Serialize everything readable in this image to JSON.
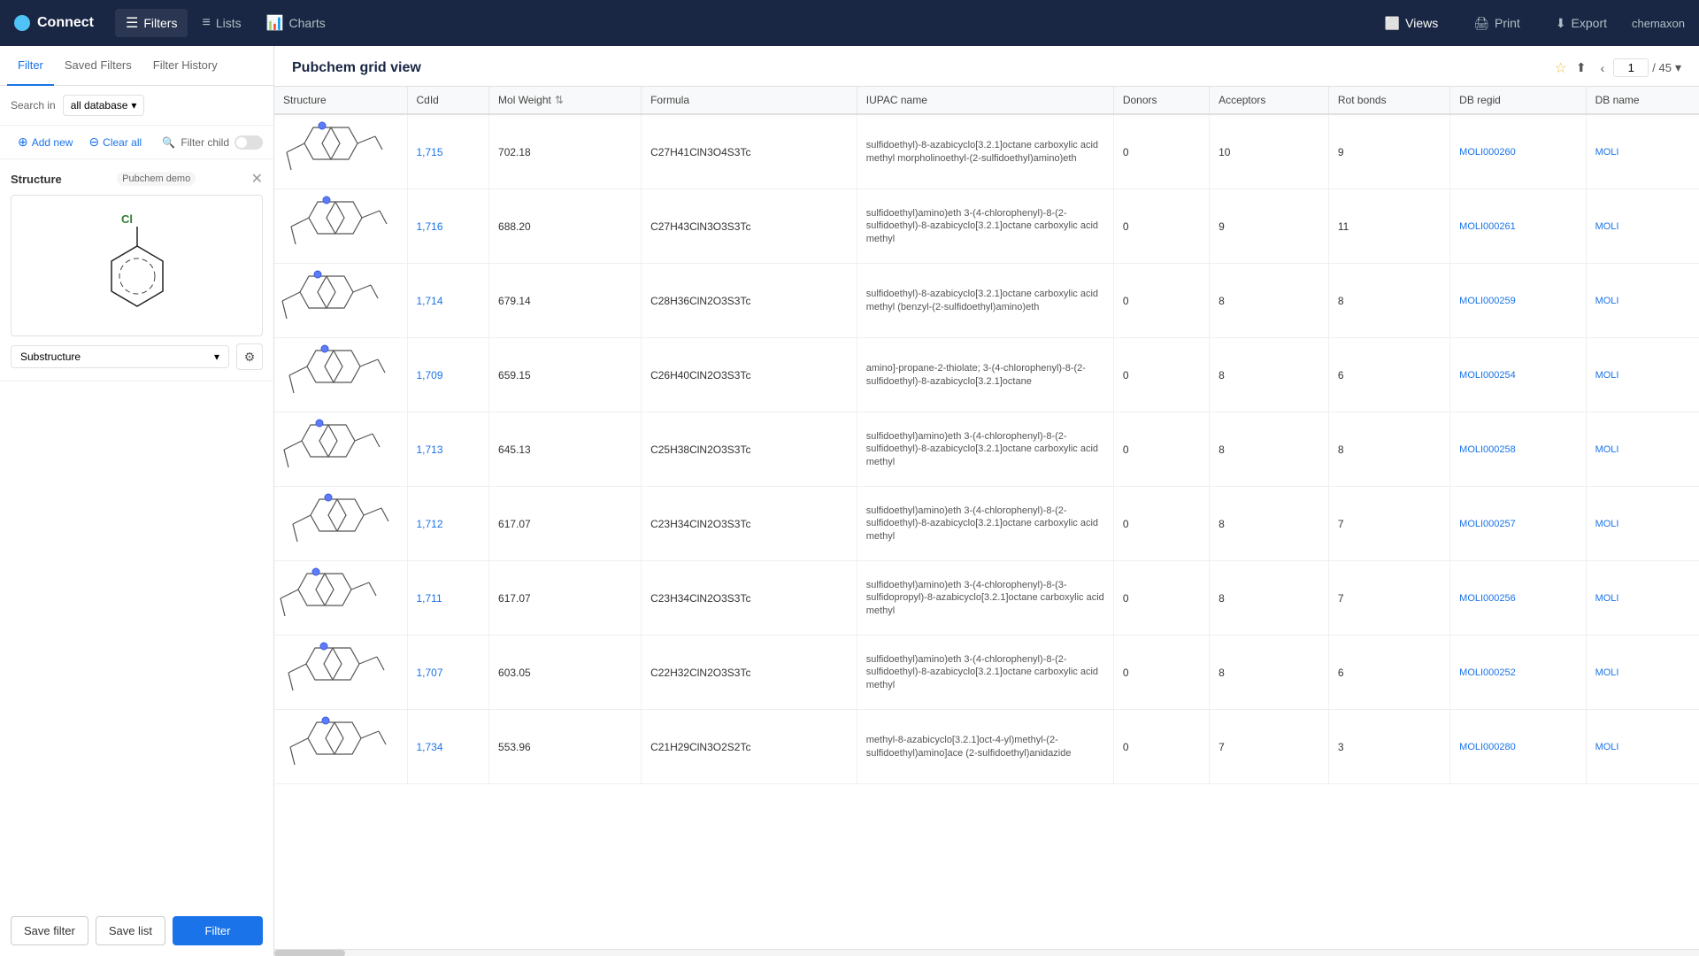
{
  "app": {
    "brand": "Connect",
    "user": "chemaxon"
  },
  "nav": {
    "items": [
      {
        "label": "Filters",
        "icon": "≡",
        "active": true
      },
      {
        "label": "Lists",
        "icon": "☰",
        "active": false
      },
      {
        "label": "Charts",
        "icon": "📊",
        "active": false
      }
    ],
    "views_label": "Views",
    "print_label": "Print",
    "export_label": "Export"
  },
  "filter_tabs": [
    {
      "label": "Filter",
      "active": true
    },
    {
      "label": "Saved Filters",
      "active": false
    },
    {
      "label": "Filter History",
      "active": false
    }
  ],
  "filter_panel": {
    "search_in_label": "Search in",
    "search_in_value": "all database",
    "add_new_label": "Add new",
    "clear_all_label": "Clear all",
    "filter_child_label": "Filter child",
    "structure_section": {
      "title": "Structure",
      "badge": "Pubchem demo",
      "filter_type": "Substructure",
      "gear_icon": "⚙"
    },
    "save_filter_label": "Save filter",
    "save_list_label": "Save list",
    "filter_label": "Filter"
  },
  "content": {
    "title": "Pubchem grid view",
    "current_page": "1",
    "total_pages": "45"
  },
  "table": {
    "columns": [
      "Structure",
      "CdId",
      "Mol Weight",
      "Formula",
      "IUPAC name",
      "Donors",
      "Acceptors",
      "Rot bonds",
      "DB regid",
      "DB name"
    ],
    "rows": [
      {
        "cdid": "1,715",
        "mol_weight": "702.18",
        "formula": "C27H41ClN3O4S3Tc",
        "iupac": "sulfidoethyl)-8-azabicyclo[3.2.1]octane carboxylic acid methyl morpholinoethyl-(2-sulfidoethyl)amino)eth",
        "donors": "0",
        "acceptors": "10",
        "rot_bonds": "9",
        "db_regid": "MOLI000260",
        "db_name": "MOLI"
      },
      {
        "cdid": "1,716",
        "mol_weight": "688.20",
        "formula": "C27H43ClN3O3S3Tc",
        "iupac": "sulfidoethyl)amino)eth 3-(4-chlorophenyl)-8-(2-sulfidoethyl)-8-azabicyclo[3.2.1]octane carboxylic acid methyl",
        "donors": "0",
        "acceptors": "9",
        "rot_bonds": "11",
        "db_regid": "MOLI000261",
        "db_name": "MOLI"
      },
      {
        "cdid": "1,714",
        "mol_weight": "679.14",
        "formula": "C28H36ClN2O3S3Tc",
        "iupac": "sulfidoethyl)-8-azabicyclo[3.2.1]octane carboxylic acid methyl (benzyl-(2-sulfidoethyl)amino)eth",
        "donors": "0",
        "acceptors": "8",
        "rot_bonds": "8",
        "db_regid": "MOLI000259",
        "db_name": "MOLI"
      },
      {
        "cdid": "1,709",
        "mol_weight": "659.15",
        "formula": "C26H40ClN2O3S3Tc",
        "iupac": "amino]-propane-2-thiolate; 3-(4-chlorophenyl)-8-(2-sulfidoethyl)-8-azabicyclo[3.2.1]octane",
        "donors": "0",
        "acceptors": "8",
        "rot_bonds": "6",
        "db_regid": "MOLI000254",
        "db_name": "MOLI"
      },
      {
        "cdid": "1,713",
        "mol_weight": "645.13",
        "formula": "C25H38ClN2O3S3Tc",
        "iupac": "sulfidoethyl)amino)eth 3-(4-chlorophenyl)-8-(2-sulfidoethyl)-8-azabicyclo[3.2.1]octane carboxylic acid methyl",
        "donors": "0",
        "acceptors": "8",
        "rot_bonds": "8",
        "db_regid": "MOLI000258",
        "db_name": "MOLI"
      },
      {
        "cdid": "1,712",
        "mol_weight": "617.07",
        "formula": "C23H34ClN2O3S3Tc",
        "iupac": "sulfidoethyl)amino)eth 3-(4-chlorophenyl)-8-(2-sulfidoethyl)-8-azabicyclo[3.2.1]octane carboxylic acid methyl",
        "donors": "0",
        "acceptors": "8",
        "rot_bonds": "7",
        "db_regid": "MOLI000257",
        "db_name": "MOLI"
      },
      {
        "cdid": "1,711",
        "mol_weight": "617.07",
        "formula": "C23H34ClN2O3S3Tc",
        "iupac": "sulfidoethyl)amino)eth 3-(4-chlorophenyl)-8-(3-sulfidopropyl)-8-azabicyclo[3.2.1]octane carboxylic acid methyl",
        "donors": "0",
        "acceptors": "8",
        "rot_bonds": "7",
        "db_regid": "MOLI000256",
        "db_name": "MOLI"
      },
      {
        "cdid": "1,707",
        "mol_weight": "603.05",
        "formula": "C22H32ClN2O3S3Tc",
        "iupac": "sulfidoethyl)amino)eth 3-(4-chlorophenyl)-8-(2-sulfidoethyl)-8-azabicyclo[3.2.1]octane carboxylic acid methyl",
        "donors": "0",
        "acceptors": "8",
        "rot_bonds": "6",
        "db_regid": "MOLI000252",
        "db_name": "MOLI"
      },
      {
        "cdid": "1,734",
        "mol_weight": "553.96",
        "formula": "C21H29ClN3O2S2Tc",
        "iupac": "methyl-8-azabicyclo[3.2.1]oct-4-yl)methyl-(2-sulfidoethyl)amino]ace (2-sulfidoethyl)anidazide",
        "donors": "0",
        "acceptors": "7",
        "rot_bonds": "3",
        "db_regid": "MOLI000280",
        "db_name": "MOLI"
      }
    ]
  }
}
